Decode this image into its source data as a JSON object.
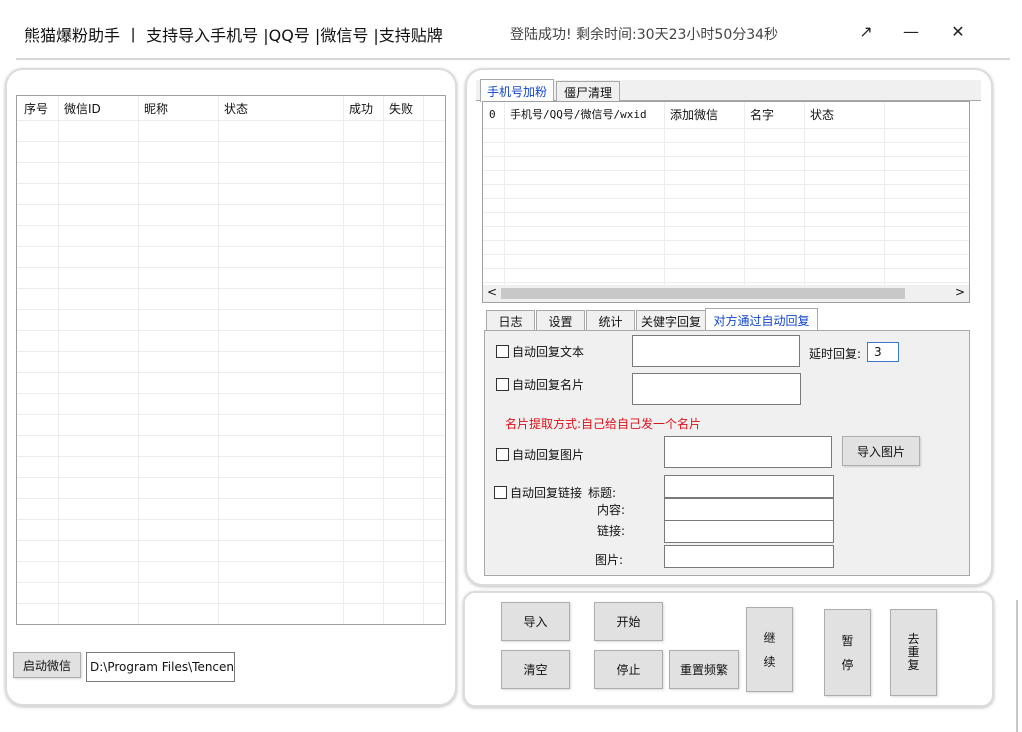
{
  "window": {
    "title": "熊猫爆粉助手 丨 支持导入手机号 |QQ号 |微信号 |支持贴牌",
    "login_status": "登陆成功!   剩余时间:30天23小时50分34秒",
    "expand_glyph": "↗",
    "minimize_glyph": "—",
    "close_glyph": "✕"
  },
  "left_grid": {
    "columns": [
      "序号",
      "微信ID",
      "昵称",
      "状态",
      "成功",
      "失败"
    ]
  },
  "left_bottom": {
    "start_wechat_label": "启动微信",
    "path_value": "D:\\Program Files\\Tencent"
  },
  "top_tabs": {
    "tab1": "手机号加粉",
    "tab2": "僵尸清理"
  },
  "right_grid": {
    "columns": [
      "0",
      "手机号/QQ号/微信号/wxid",
      "添加微信",
      "名字",
      "状态"
    ],
    "scroll_left": "<",
    "scroll_right": ">"
  },
  "sub_tabs": [
    "日志",
    "设置",
    "统计",
    "关健字回复",
    "对方通过自动回复"
  ],
  "auto_reply": {
    "text_label": "自动回复文本",
    "delay_label": "延时回复:",
    "delay_value": "3",
    "card_label": "自动回复名片",
    "card_hint": "名片提取方式:自己给自己发一个名片",
    "image_label": "自动回复图片",
    "import_image_button": "导入图片",
    "link_label": "自动回复链接",
    "link_title_label": "标题:",
    "link_content_label": "内容:",
    "link_url_label": "链接:",
    "link_image_label": "图片:"
  },
  "controls": {
    "import": "导入",
    "start": "开始",
    "clear": "清空",
    "stop": "停止",
    "reset_freq": "重置频繁",
    "continue_1": "继",
    "continue_2": "续",
    "pause_1": "暂",
    "pause_2": "停",
    "dedup_1": "去",
    "dedup_2": "重",
    "dedup_3": "复"
  },
  "colors": {
    "hint_red": "#e0101a",
    "active_tab_blue": "#1144cc"
  }
}
